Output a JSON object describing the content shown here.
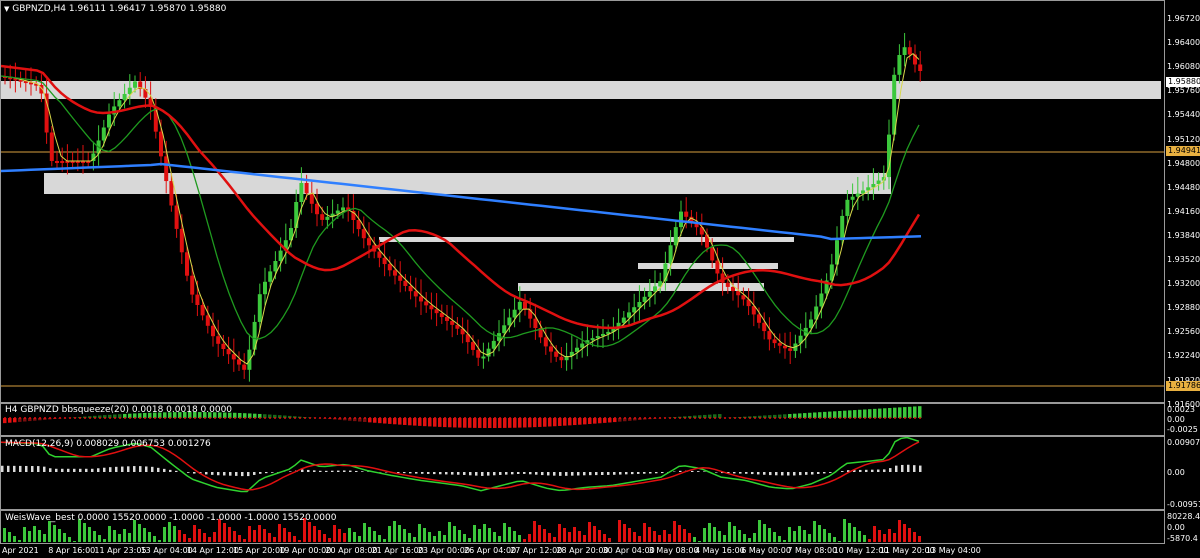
{
  "header": {
    "dropdown_icon": "triangle-down-icon",
    "symbol": "GBPNZD,H4",
    "ohlc": "1.96111 1.96417 1.95870 1.95880"
  },
  "price_scale": [
    "1.96720",
    "1.96400",
    "1.96080",
    "1.95760",
    "1.95440",
    "1.95120",
    "1.94800",
    "1.94480",
    "1.94160",
    "1.93840",
    "1.93520",
    "1.93200",
    "1.92880",
    "1.92560",
    "1.92240",
    "1.91920",
    "1.91600"
  ],
  "price_tags": {
    "current": "1.95880",
    "upper_line": "1.94941",
    "lower_line": "1.91786"
  },
  "indicators": {
    "bbsqueeze": {
      "title": "H4 GBPNZD bbsqueeze(20) 0.0018 0.0018 0.0000",
      "scale": [
        "0.0023",
        "0.00",
        "-0.0025"
      ]
    },
    "macd": {
      "title": "MACD(12,26,9) 0.008029 0.006753 0.001276",
      "scale": [
        "0.009077",
        "0.00",
        "-0.009511"
      ]
    },
    "weiswave": {
      "title": "WeisWave_best 0.0000 15520.0000 -1.0000 -1.0000 -1.0000 15520.0000",
      "scale": [
        "80228.4",
        "0.00",
        "-5870.4"
      ]
    }
  },
  "time_axis": [
    "Apr 2021",
    "8 Apr 16:00",
    "11 Apr 23:05",
    "13 Apr 04:00",
    "14 Apr 12:00",
    "15 Apr 20:00",
    "19 Apr 00:00",
    "20 Apr 08:00",
    "21 Apr 16:00",
    "23 Apr 00:00",
    "26 Apr 04:00",
    "27 Apr 12:00",
    "28 Apr 20:00",
    "30 Apr 04:00",
    "3 May 08:00",
    "4 May 16:00",
    "6 May 00:00",
    "7 May 08:00",
    "10 May 12:00",
    "11 May 20:00",
    "13 May 04:00"
  ],
  "chart_data": {
    "type": "candlestick",
    "title": "GBPNZD,H4",
    "series": [
      {
        "name": "GBPNZD,H4",
        "ohlc_last": [
          1.96111,
          1.96417,
          1.9587,
          1.9588
        ]
      }
    ],
    "ylim": [
      1.916,
      1.968
    ],
    "horizontal_levels": [
      1.94941,
      1.91786
    ],
    "colors": {
      "bull": "#3cc83c",
      "bear": "#e01010",
      "ma_red": "#e01010",
      "ma_blue": "#2f7fff",
      "ma_green": "#1f9a1f",
      "ma_yellow": "#d8d84a",
      "zone": "#d8d8d8",
      "level_line": "#d8a040"
    }
  }
}
